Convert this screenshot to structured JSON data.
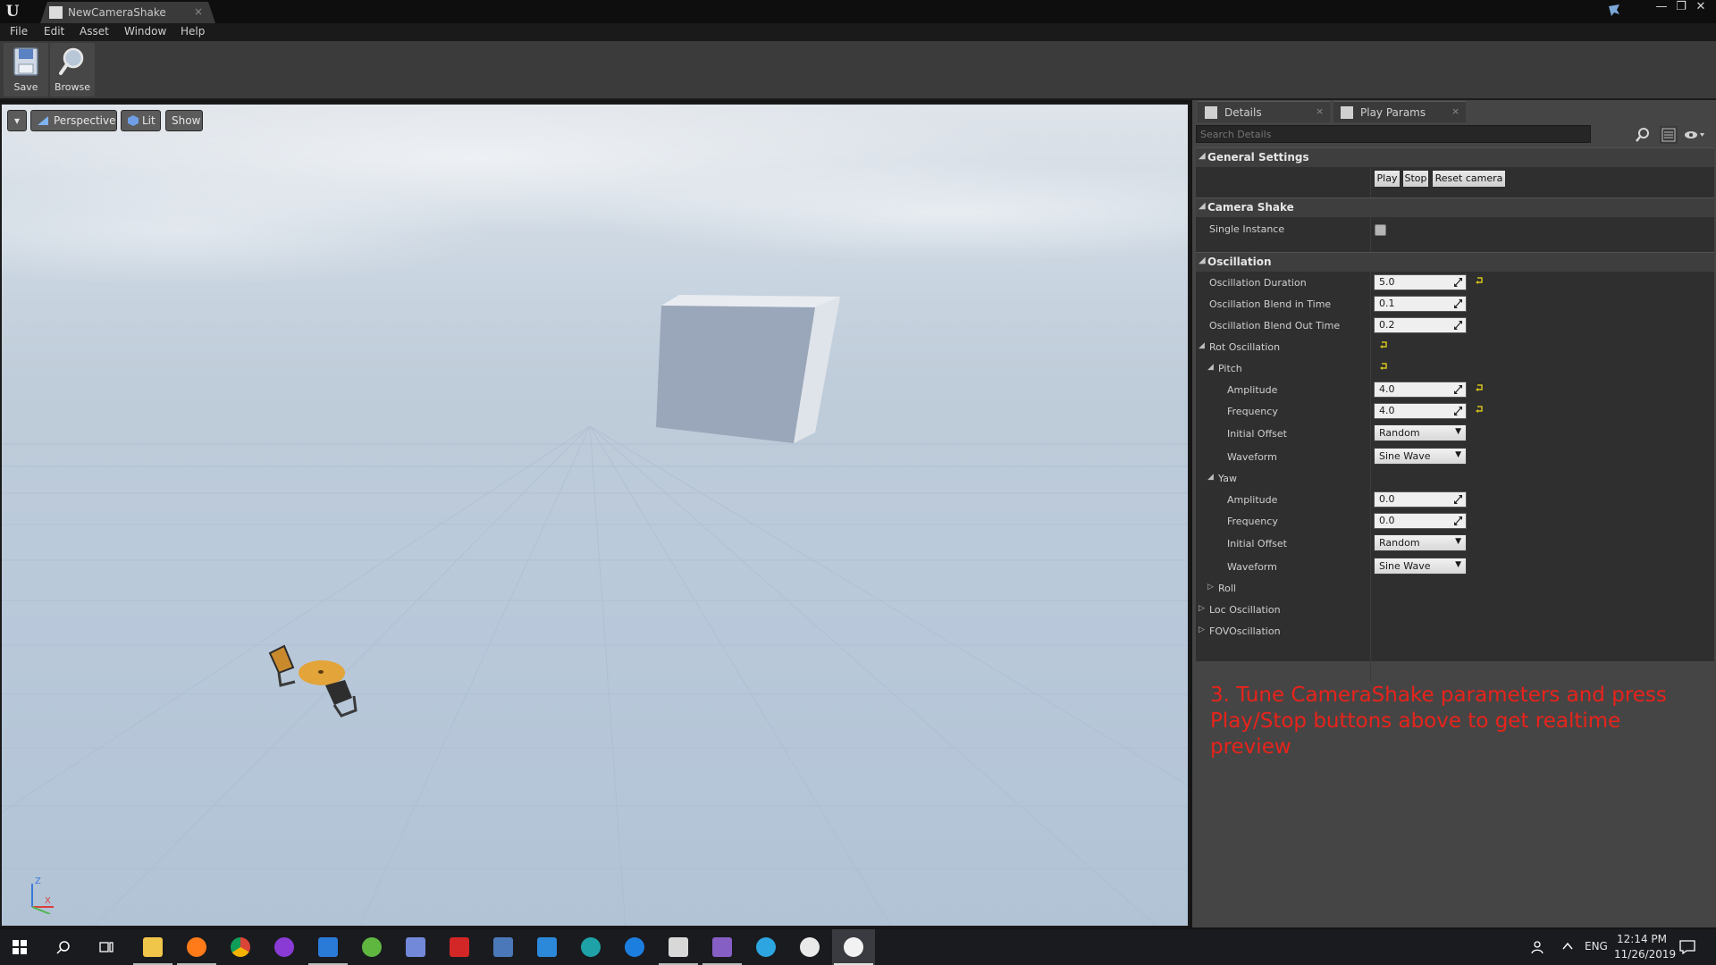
{
  "window": {
    "tab_title": "NewCameraShake",
    "tab_close": "×",
    "minimize": "—",
    "restore": "❐",
    "close": "✕"
  },
  "menu": [
    "File",
    "Edit",
    "Asset",
    "Window",
    "Help"
  ],
  "toolbar": {
    "save_label": "Save",
    "browse_label": "Browse"
  },
  "viewport": {
    "options_arrow": "▾",
    "perspective_label": "Perspective",
    "lit_label": "Lit",
    "show_label": "Show",
    "gizmo_z": "Z",
    "gizmo_x": "X"
  },
  "panel": {
    "tabs": [
      {
        "label": "Details",
        "close": "×"
      },
      {
        "label": "Play Params",
        "close": "×"
      }
    ],
    "search_placeholder": "Search Details"
  },
  "details": {
    "general_settings": {
      "title": "General Settings",
      "buttons": [
        "Play",
        "Stop",
        "Reset camera"
      ]
    },
    "camera_shake": {
      "title": "Camera Shake",
      "single_instance_label": "Single Instance",
      "single_instance_checked": false
    },
    "oscillation": {
      "title": "Oscillation",
      "duration_label": "Oscillation Duration",
      "duration_value": "5.0",
      "blend_in_label": "Oscillation Blend in Time",
      "blend_in_value": "0.1",
      "blend_out_label": "Oscillation Blend Out Time",
      "blend_out_value": "0.2",
      "rot_label": "Rot Oscillation",
      "pitch": {
        "label": "Pitch",
        "amplitude_label": "Amplitude",
        "amplitude_value": "4.0",
        "frequency_label": "Frequency",
        "frequency_value": "4.0",
        "initial_offset_label": "Initial Offset",
        "initial_offset_value": "Random",
        "waveform_label": "Waveform",
        "waveform_value": "Sine Wave"
      },
      "yaw": {
        "label": "Yaw",
        "amplitude_label": "Amplitude",
        "amplitude_value": "0.0",
        "frequency_label": "Frequency",
        "frequency_value": "0.0",
        "initial_offset_label": "Initial Offset",
        "initial_offset_value": "Random",
        "waveform_label": "Waveform",
        "waveform_value": "Sine Wave"
      },
      "roll_label": "Roll",
      "loc_label": "Loc Oscillation",
      "fov_label": "FOVOscillation"
    }
  },
  "annotation_text": "3. Tune CameraShake parameters and press Play/Stop buttons above to get realtime preview",
  "taskbar": {
    "language": "ENG",
    "time": "12:14 PM",
    "date": "11/26/2019"
  },
  "colors": {
    "annotation": "#e8231b",
    "reset_arrow": "#d6c31c",
    "panel_bg": "#454545"
  }
}
